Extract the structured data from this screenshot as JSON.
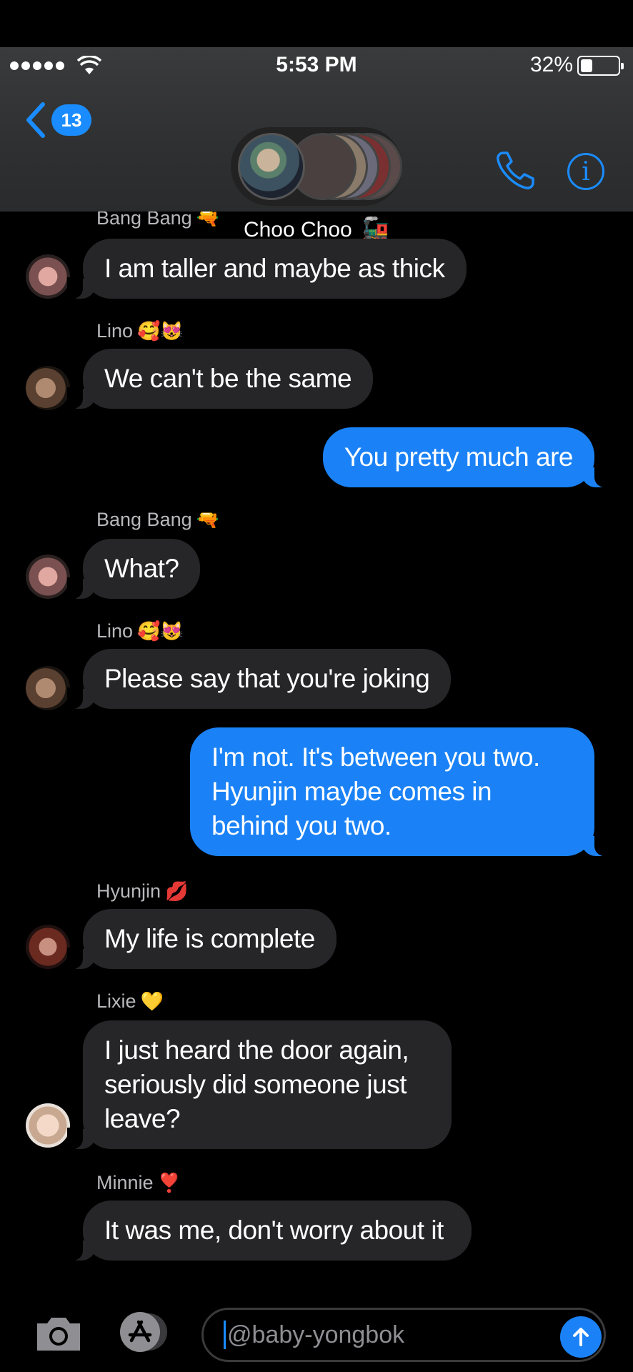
{
  "status_bar": {
    "time": "5:53 PM",
    "battery": "32%",
    "battery_level": 0.32
  },
  "header": {
    "back_count": "13",
    "group_name": "Choo Choo",
    "group_emoji": "🚂",
    "info_glyph": "i"
  },
  "colors": {
    "accent": "#1a8cff",
    "outgoing_bubble": "#1a82f6",
    "incoming_bubble": "#262628"
  },
  "messages": [
    {
      "sender": "Bang Bang",
      "sender_emoji": "🔫",
      "text": ""
    },
    {
      "text": "I am taller and maybe as thick"
    },
    {
      "sender": "Lino",
      "sender_emoji": "🥰😻",
      "text": "We can't be the same"
    },
    {
      "text": "You pretty much are"
    },
    {
      "sender": "Bang Bang",
      "sender_emoji": "🔫",
      "text": "What?"
    },
    {
      "sender": "Lino",
      "sender_emoji": "🥰😻",
      "text": "Please say that you're joking"
    },
    {
      "text": "I'm not. It's between you two. Hyunjin maybe comes in behind you two."
    },
    {
      "sender": "Hyunjin",
      "sender_emoji": "💋",
      "text": "My life is complete"
    },
    {
      "sender": "Lixie",
      "sender_emoji": "💛",
      "text": "I just heard the door again, seriously did someone just leave?"
    },
    {
      "sender": "Minnie",
      "sender_emoji": "❣️",
      "text": "It was me, don't worry about it"
    }
  ],
  "input": {
    "value": "@baby-yongbok"
  },
  "icons": {
    "back": "chevron-left-icon",
    "call": "phone-icon",
    "info": "info-icon",
    "camera": "camera-icon",
    "apps": "app-store-icon",
    "send": "arrow-up-icon"
  }
}
